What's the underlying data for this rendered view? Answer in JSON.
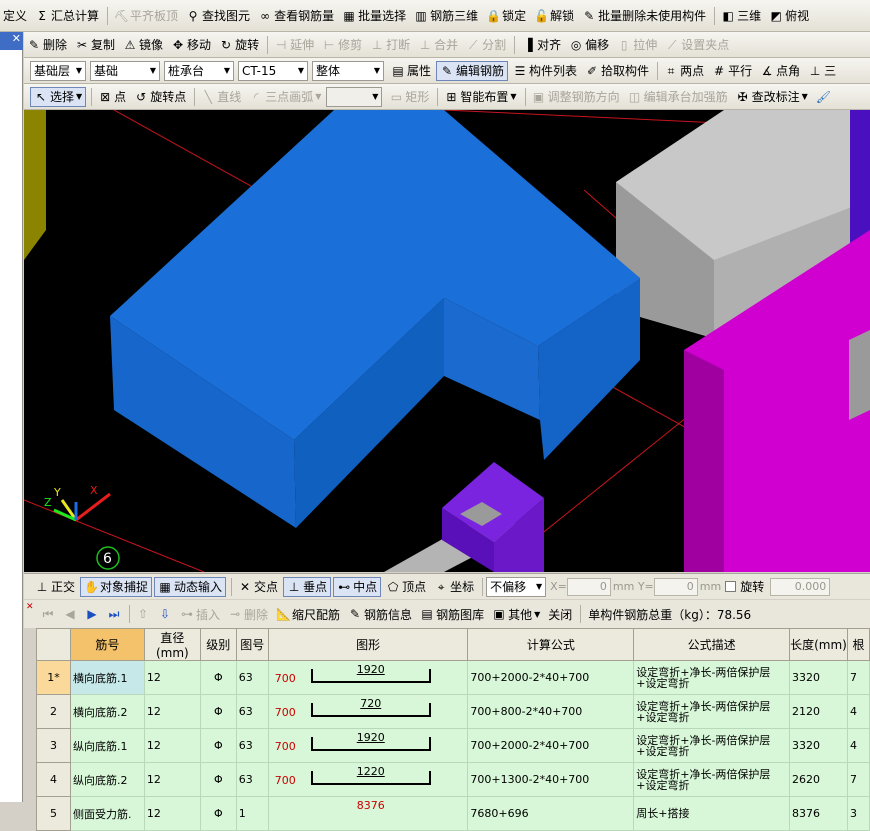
{
  "top_toolbar": [
    {
      "label": "定义",
      "icon": "",
      "disabled": false
    },
    {
      "label": "汇总计算",
      "icon": "Σ",
      "disabled": false
    },
    {
      "label": "平齐板顶",
      "icon": "⛏",
      "disabled": true
    },
    {
      "label": "查找图元",
      "icon": "⚲",
      "disabled": false
    },
    {
      "label": "查看钢筋量",
      "icon": "∞",
      "disabled": false
    },
    {
      "label": "批量选择",
      "icon": "▦",
      "disabled": false
    },
    {
      "label": "钢筋三维",
      "icon": "▥",
      "disabled": false
    },
    {
      "label": "锁定",
      "icon": "🔒",
      "disabled": false
    },
    {
      "label": "解锁",
      "icon": "🔓",
      "disabled": false
    },
    {
      "label": "批量删除未使用构件",
      "icon": "✎",
      "disabled": false
    },
    {
      "label": "三维",
      "icon": "◧",
      "disabled": false
    },
    {
      "label": "俯视",
      "icon": "◩",
      "disabled": false
    }
  ],
  "edit_toolbar": [
    {
      "label": "删除",
      "icon": "✎",
      "disabled": false
    },
    {
      "label": "复制",
      "icon": "✂",
      "disabled": false
    },
    {
      "label": "镜像",
      "icon": "⚠",
      "disabled": false
    },
    {
      "label": "移动",
      "icon": "✥",
      "disabled": false
    },
    {
      "label": "旋转",
      "icon": "↻",
      "disabled": false
    },
    {
      "label": "延伸",
      "icon": "⊣",
      "disabled": true
    },
    {
      "label": "修剪",
      "icon": "⊢",
      "disabled": true
    },
    {
      "label": "打断",
      "icon": "⊥",
      "disabled": true
    },
    {
      "label": "合并",
      "icon": "⊥",
      "disabled": true
    },
    {
      "label": "分割",
      "icon": "⟋",
      "disabled": true
    },
    {
      "label": "对齐",
      "icon": "▐",
      "disabled": false
    },
    {
      "label": "偏移",
      "icon": "◎",
      "disabled": false
    },
    {
      "label": "拉伸",
      "icon": "▯",
      "disabled": true
    },
    {
      "label": "设置夹点",
      "icon": "⟋",
      "disabled": true
    }
  ],
  "component_bar": {
    "floor": "基础层",
    "category": "基础",
    "type": "桩承台",
    "name": "CT-15",
    "mode": "整体",
    "buttons": [
      {
        "label": "属性",
        "icon": "▤"
      },
      {
        "label": "编辑钢筋",
        "icon": "✎"
      },
      {
        "label": "构件列表",
        "icon": "☰"
      },
      {
        "label": "拾取构件",
        "icon": "✐"
      },
      {
        "label": "两点",
        "icon": "⌗"
      },
      {
        "label": "平行",
        "icon": "#"
      },
      {
        "label": "点角",
        "icon": "∡"
      },
      {
        "label": "三",
        "icon": "⊥"
      }
    ]
  },
  "draw_toolbar": {
    "select": "选择",
    "point": "点",
    "rotate_point": "旋转点",
    "line": "直线",
    "arc": "三点画弧",
    "rect": "矩形",
    "smart": "智能布置",
    "adjust": "调整钢筋方向",
    "edit_cap": "编辑承台加强筋",
    "check": "查改标注"
  },
  "viewport": {
    "axis_marker": "6",
    "axis_labels": {
      "x": "X",
      "y": "Y",
      "z": "Z"
    }
  },
  "snap_bar": {
    "ortho": "正交",
    "snap": "对象捕捉",
    "dynamic": "动态输入",
    "intersection": "交点",
    "perpendicular": "垂点",
    "midpoint": "中点",
    "vertex": "顶点",
    "coordinate": "坐标",
    "offset_mode": "不偏移",
    "x_label": "X=",
    "x_value": "0",
    "y_label": "mm  Y=",
    "y_value": "0",
    "unit": "mm",
    "rotate": "旋转",
    "rotate_value": "0.000"
  },
  "rebar_panel": {
    "insert": "插入",
    "delete": "删除",
    "scale": "缩尺配筋",
    "info": "钢筋信息",
    "library": "钢筋图库",
    "other": "其他",
    "close": "关闭",
    "total_label": "单构件钢筋总重（kg）：78.56"
  },
  "table": {
    "headers": [
      "",
      "筋号",
      "直径(mm)",
      "级别",
      "图号",
      "图形",
      "计算公式",
      "公式描述",
      "长度(mm)",
      "根"
    ],
    "rows": [
      {
        "no": "1*",
        "name": "横向底筋.1",
        "dia": "12",
        "grade": "Φ",
        "fig": "63",
        "hook": "700",
        "len_shape": "1920",
        "formula": "700+2000-2*40+700",
        "desc": "设定弯折+净长-两倍保护层+设定弯折",
        "length": "3320",
        "count": "7"
      },
      {
        "no": "2",
        "name": "横向底筋.2",
        "dia": "12",
        "grade": "Φ",
        "fig": "63",
        "hook": "700",
        "len_shape": "720",
        "formula": "700+800-2*40+700",
        "desc": "设定弯折+净长-两倍保护层+设定弯折",
        "length": "2120",
        "count": "4"
      },
      {
        "no": "3",
        "name": "纵向底筋.1",
        "dia": "12",
        "grade": "Φ",
        "fig": "63",
        "hook": "700",
        "len_shape": "1920",
        "formula": "700+2000-2*40+700",
        "desc": "设定弯折+净长-两倍保护层+设定弯折",
        "length": "3320",
        "count": "4"
      },
      {
        "no": "4",
        "name": "纵向底筋.2",
        "dia": "12",
        "grade": "Φ",
        "fig": "63",
        "hook": "700",
        "len_shape": "1220",
        "formula": "700+1300-2*40+700",
        "desc": "设定弯折+净长-两倍保护层+设定弯折",
        "length": "2620",
        "count": "7"
      },
      {
        "no": "5",
        "name": "侧面受力筋.",
        "dia": "12",
        "grade": "Φ",
        "fig": "1",
        "hook": "",
        "len_shape": "8376",
        "formula": "7680+696",
        "desc": "周长+搭接",
        "length": "8376",
        "count": "3"
      }
    ]
  }
}
